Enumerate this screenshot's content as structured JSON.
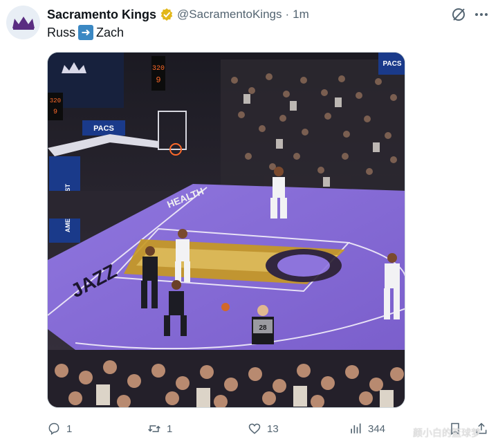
{
  "author": {
    "display_name": "Sacramento Kings",
    "handle": "@SacramentoKings",
    "separator": "·",
    "time": "1m",
    "verified": true,
    "avatar_icon": "kings-crown-logo"
  },
  "tweet": {
    "text_before": "Russ",
    "emoji": "right-arrow-emoji",
    "text_after": "Zach"
  },
  "media": {
    "type": "video",
    "description_icon": "basketball-game-frame",
    "scoreboard_top": "320",
    "scoreboard_bottom": "9",
    "left_shotclock_top": "320",
    "left_shotclock_bottom": "9",
    "sponsor_banner": "PACS",
    "sponsor_corner": "PACS",
    "court_wordmark": "JAZZ",
    "baseline_ad": "HEALTH",
    "stanchion_text": "AMERICA FIRST",
    "referee_number": "28"
  },
  "actions": {
    "reply_count": "1",
    "retweet_count": "1",
    "like_count": "13",
    "views_count": "344"
  },
  "watermark": "颜小白的篮球梦",
  "colors": {
    "kings_purple": "#5a2d81",
    "court_purple": "#8a6fd6",
    "verified_gold": "#e2b719",
    "text_secondary": "#536471"
  }
}
